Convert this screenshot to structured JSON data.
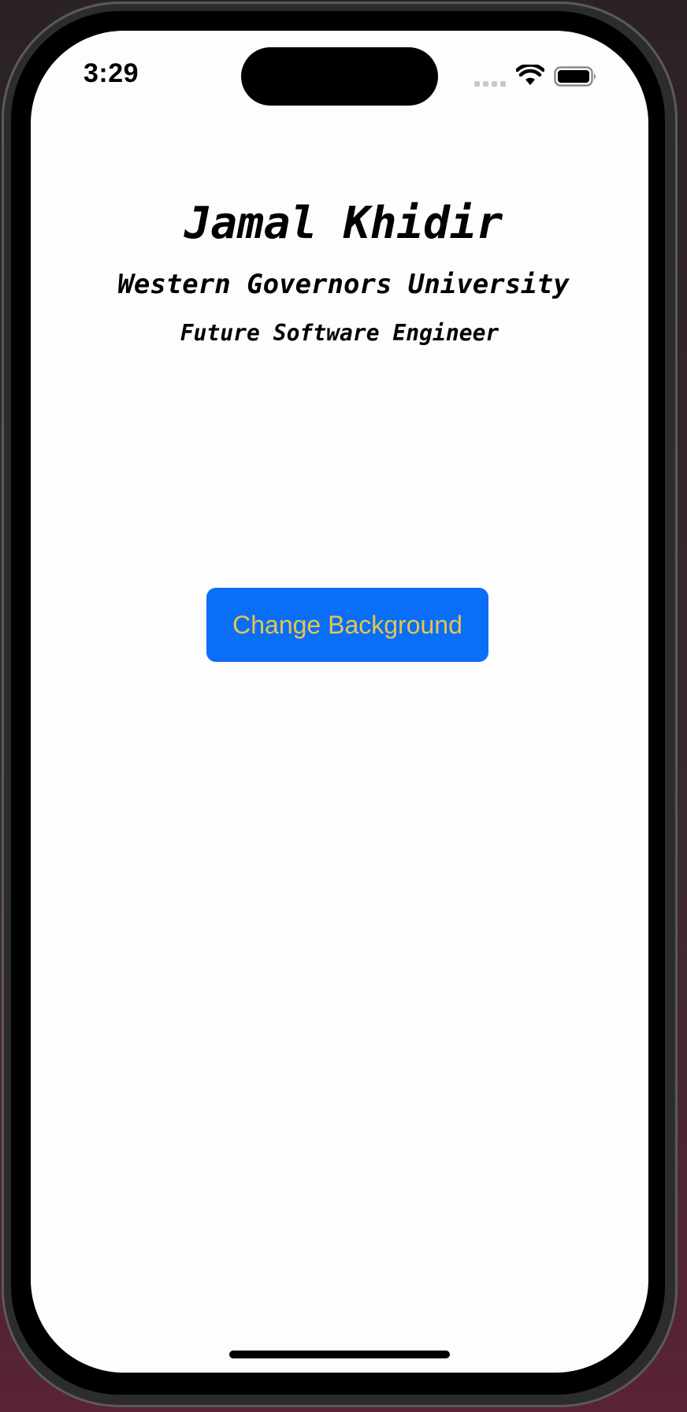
{
  "status_bar": {
    "time": "3:29",
    "icons": [
      "cellular-signal-icon",
      "wifi-icon",
      "battery-icon"
    ]
  },
  "profile": {
    "name": "Jamal Khidir",
    "school": "Western Governors University",
    "role": "Future Software Engineer"
  },
  "actions": {
    "change_background_label": "Change Background"
  },
  "colors": {
    "button_background": "#0a6ef8",
    "button_text": "#e8c547",
    "screen_background": "#fdfdfd"
  }
}
